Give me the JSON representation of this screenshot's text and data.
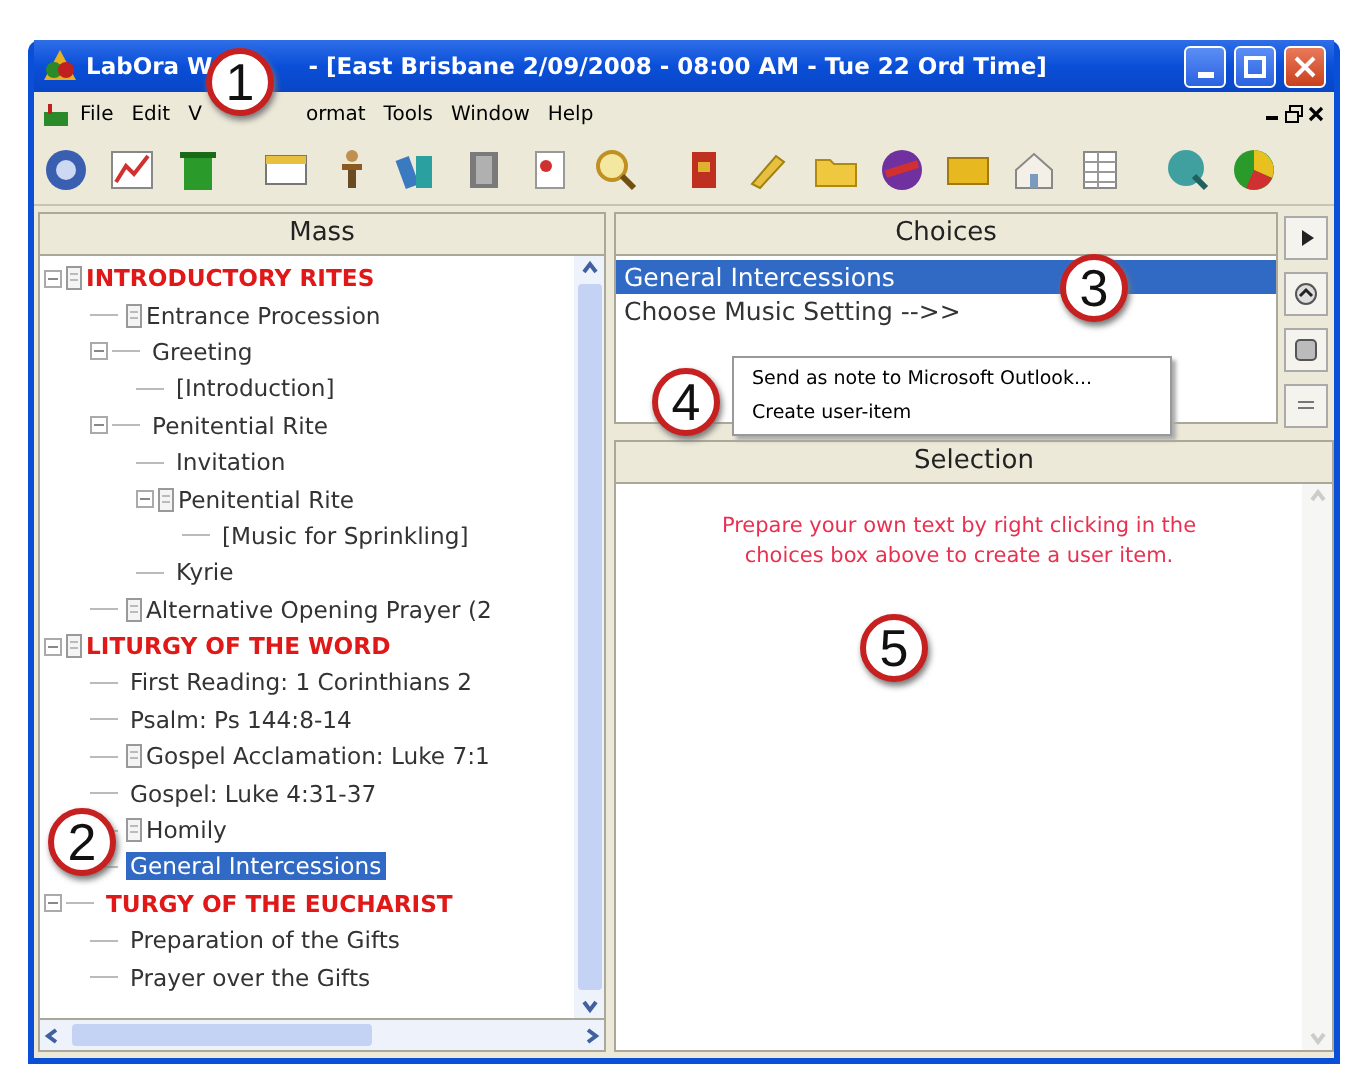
{
  "window": {
    "title_left": "LabOra W",
    "title_right": "- [East Brisbane 2/09/2008  - 08:00 AM - Tue 22 Ord Time]"
  },
  "menu": [
    "File",
    "Edit",
    "V",
    "ormat",
    "Tools",
    "Window",
    "Help"
  ],
  "mass_panel": {
    "header": "Mass",
    "tree": [
      {
        "label": "INTRODUCTORY RITES",
        "kind": "heading",
        "expanded": true,
        "marked": true,
        "selected": false,
        "children": [
          {
            "label": "Entrance Procession",
            "kind": "item",
            "marked": true,
            "selected": false
          },
          {
            "label": "Greeting",
            "kind": "item",
            "expanded": true,
            "selected": false,
            "children": [
              {
                "label": "[Introduction]",
                "kind": "item",
                "selected": false
              }
            ]
          },
          {
            "label": "Penitential Rite",
            "kind": "item",
            "expanded": true,
            "selected": false,
            "children": [
              {
                "label": "Invitation",
                "kind": "item",
                "selected": false
              },
              {
                "label": "Penitential Rite",
                "kind": "item",
                "expanded": true,
                "marked": true,
                "selected": false,
                "children": [
                  {
                    "label": "[Music for Sprinkling]",
                    "kind": "item",
                    "selected": false
                  }
                ]
              },
              {
                "label": "Kyrie",
                "kind": "item",
                "selected": false
              }
            ]
          },
          {
            "label": "Alternative Opening Prayer (2",
            "kind": "item",
            "marked": true,
            "selected": false
          }
        ]
      },
      {
        "label": "LITURGY OF THE WORD",
        "kind": "heading",
        "expanded": true,
        "marked": true,
        "selected": false,
        "children": [
          {
            "label": "First Reading: 1 Corinthians 2",
            "kind": "item",
            "selected": false
          },
          {
            "label": "Psalm: Ps 144:8-14",
            "kind": "item",
            "selected": false
          },
          {
            "label": "Gospel Acclamation: Luke 7:1",
            "kind": "item",
            "marked": true,
            "selected": false
          },
          {
            "label": "Gospel: Luke 4:31-37",
            "kind": "item",
            "selected": false
          },
          {
            "label": "Homily",
            "kind": "item",
            "marked": true,
            "selected": false
          },
          {
            "label": "General Intercessions",
            "kind": "item",
            "selected": true
          }
        ]
      },
      {
        "label": "TURGY OF THE EUCHARIST",
        "kind": "heading",
        "expanded": true,
        "selected": false,
        "children": [
          {
            "label": "Preparation of the Gifts",
            "kind": "item",
            "selected": false
          },
          {
            "label": "Prayer over the Gifts",
            "kind": "item",
            "selected": false
          }
        ]
      }
    ]
  },
  "choices_panel": {
    "header": "Choices",
    "items": [
      {
        "label": "General Intercessions",
        "selected": true
      },
      {
        "label": "Choose Music Setting -->>",
        "selected": false
      }
    ]
  },
  "context_menu": [
    "Send as note to Microsoft Outlook...",
    "Create user-item"
  ],
  "selection_panel": {
    "header": "Selection",
    "message": "Prepare your own text by right clicking in the choices box above to create a user item."
  },
  "callouts": [
    "1",
    "2",
    "3",
    "4",
    "5"
  ]
}
